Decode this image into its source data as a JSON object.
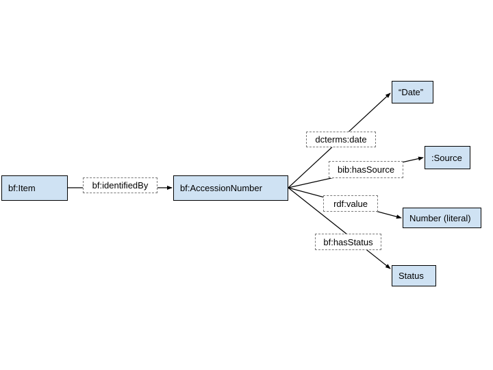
{
  "nodes": {
    "item": "bf:Item",
    "accession": "bf:AccessionNumber",
    "date": "“Date”",
    "source": ":Source",
    "number": "Number (literal)",
    "status": "Status"
  },
  "edges": {
    "identified_by": "bf:identifiedBy",
    "date": "dcterms:date",
    "has_source": "bib:hasSource",
    "value": "rdf:value",
    "has_status": "bf:hasStatus"
  },
  "colors": {
    "node_fill": "#cfe2f3",
    "stroke": "#000000",
    "label_border": "#777777"
  }
}
